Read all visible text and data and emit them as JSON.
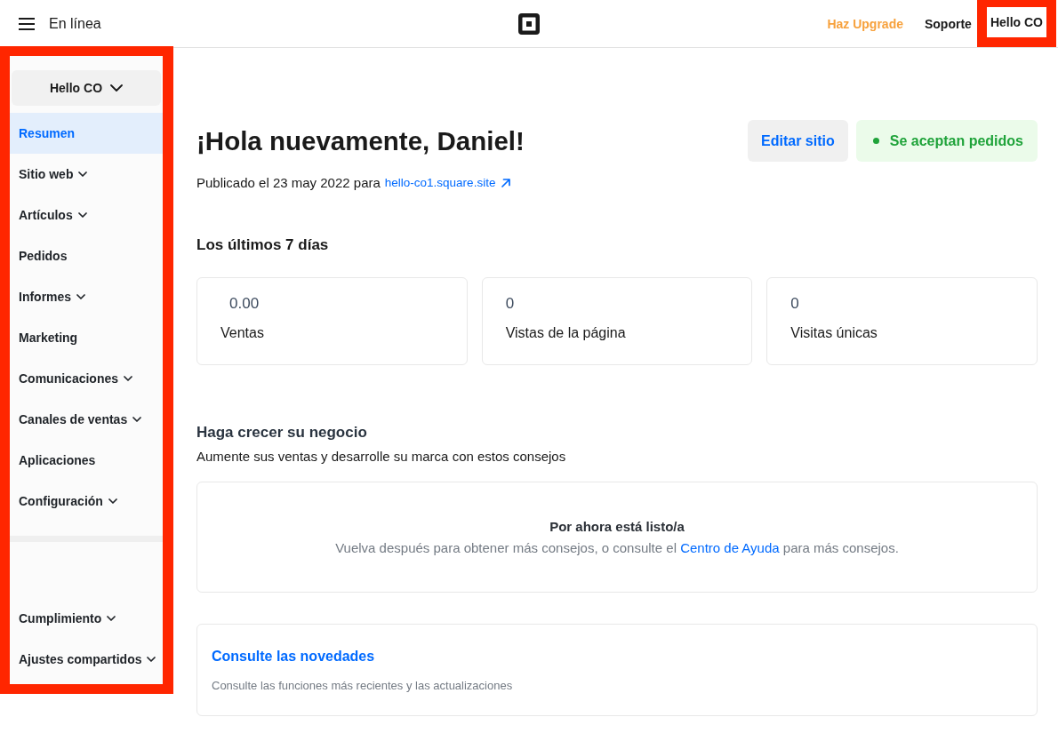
{
  "top_bar": {
    "title": "En línea",
    "nav": [
      {
        "label": "Haz Upgrade",
        "kind": "upgrade",
        "highlighted": false
      },
      {
        "label": "Soporte",
        "kind": "link",
        "highlighted": false
      },
      {
        "label": "Hello CO",
        "kind": "account",
        "highlighted": true
      }
    ]
  },
  "sidebar": {
    "highlighted": true,
    "account": "Hello CO",
    "items": [
      {
        "label": "Resumen",
        "selected": true,
        "expandable": false
      },
      {
        "label": "Sitio web",
        "selected": false,
        "expandable": true
      },
      {
        "label": "Artículos",
        "selected": false,
        "expandable": true
      },
      {
        "label": "Pedidos",
        "selected": false,
        "expandable": false
      },
      {
        "label": "Informes",
        "selected": false,
        "expandable": true
      },
      {
        "label": "Marketing",
        "selected": false,
        "expandable": false
      },
      {
        "label": "Comunicaciones",
        "selected": false,
        "expandable": true
      },
      {
        "label": "Canales de ventas",
        "selected": false,
        "expandable": true
      },
      {
        "label": "Aplicaciones",
        "selected": false,
        "expandable": false
      },
      {
        "label": "Configuración",
        "selected": false,
        "expandable": true
      }
    ],
    "footer_items": [
      {
        "label": "Cumplimiento",
        "selected": false,
        "expandable": true
      },
      {
        "label": "Ajustes compartidos",
        "selected": false,
        "expandable": true
      }
    ]
  },
  "header": {
    "greeting": "¡Hola nuevamente, Daniel!",
    "published": "Publicado el 23 may 2022 para",
    "site_link": "hello-co1.square.site",
    "actions": [
      {
        "label": "Editar sitio",
        "kind": "button"
      },
      {
        "label": "Se aceptan pedidos",
        "kind": "status"
      }
    ]
  },
  "stats": {
    "title": "Los últimos 7 días",
    "cards": [
      {
        "value": "0.00",
        "label": "Ventas",
        "kind": "currency"
      },
      {
        "value": "0",
        "label": "Vistas de la página",
        "kind": "count"
      },
      {
        "value": "0",
        "label": "Visitas únicas",
        "kind": "count"
      }
    ]
  },
  "tips": {
    "title": "Haga crecer su negocio",
    "subtitle": "Aumente sus ventas y desarrolle su marca con estos consejos",
    "empty_state": {
      "title": "Por ahora está listo/a",
      "text_before": "Vuelva después para obtener más consejos, o consulte el",
      "link": "Centro de Ayuda",
      "text_after": "para más consejos."
    }
  },
  "news": {
    "title": "Consulte las novedades",
    "text": "Consulte las funciones más recientes y las actualizaciones"
  }
}
